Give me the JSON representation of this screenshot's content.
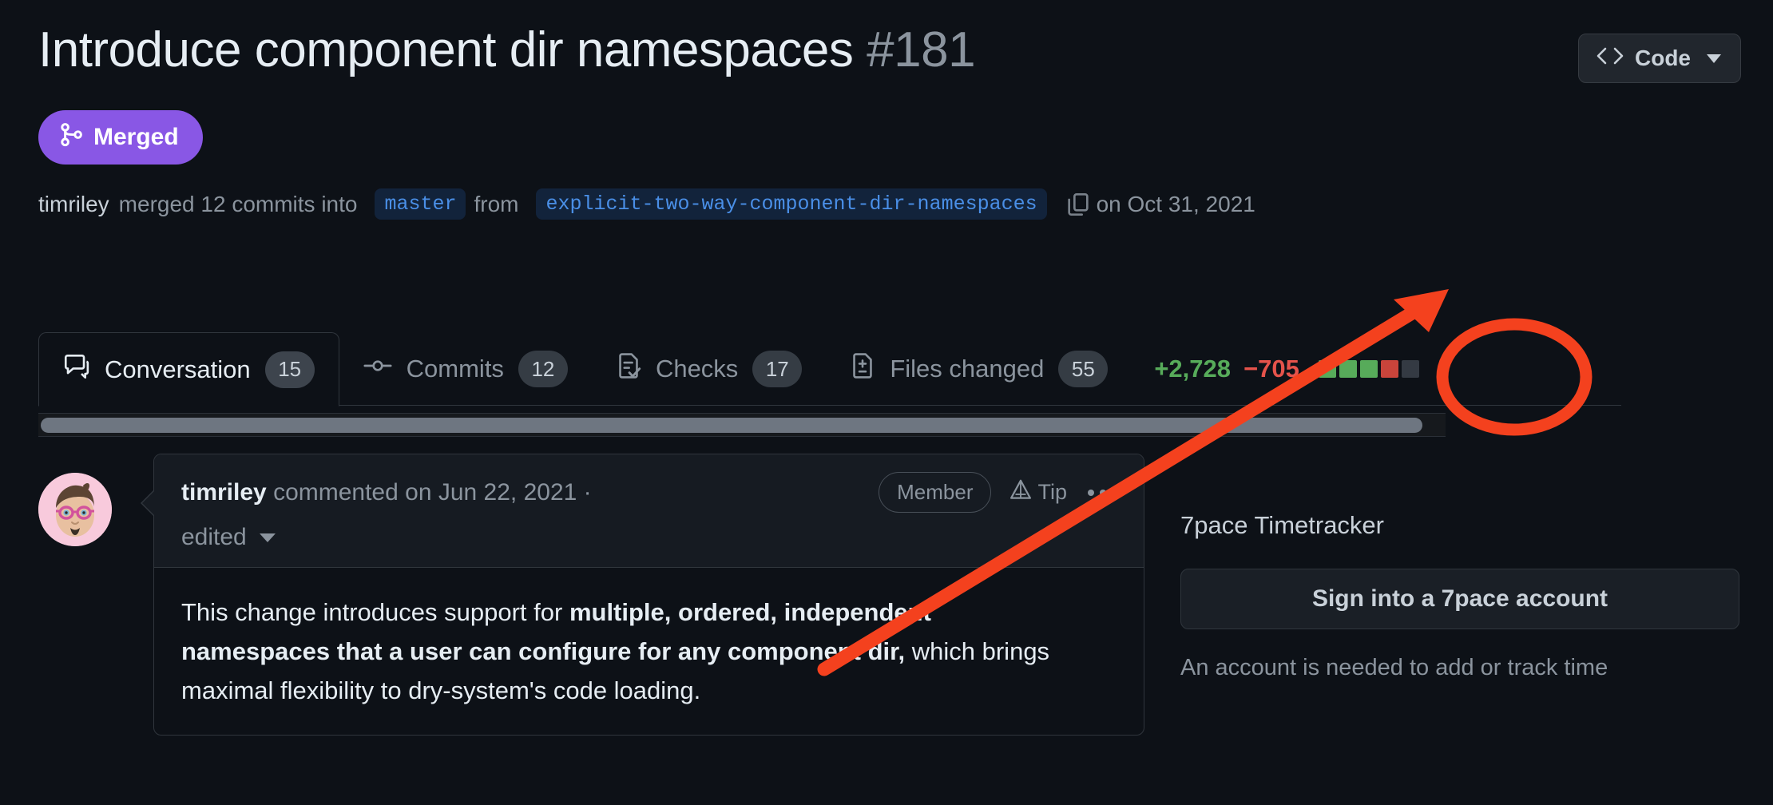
{
  "header": {
    "title": "Introduce component dir namespaces",
    "number": "#181",
    "code_button_label": "Code"
  },
  "state": {
    "badge_label": "Merged",
    "badge_color": "#8957e5"
  },
  "meta": {
    "author": "timriley",
    "action_text": "merged 12 commits into",
    "base_branch": "master",
    "from_text": "from",
    "head_branch": "explicit-two-way-component-dir-namespaces",
    "date_text": "on Oct 31, 2021"
  },
  "tabs": [
    {
      "label": "Conversation",
      "count": "15",
      "icon": "comment-icon",
      "active": true
    },
    {
      "label": "Commits",
      "count": "12",
      "icon": "commit-icon",
      "active": false
    },
    {
      "label": "Checks",
      "count": "17",
      "icon": "checks-icon",
      "active": false
    },
    {
      "label": "Files changed",
      "count": "55",
      "icon": "file-diff-icon",
      "active": false
    }
  ],
  "diffstat": {
    "additions": "+2,728",
    "deletions": "−705",
    "add_color": "#57ab5a",
    "del_color": "#e5534b",
    "blocks": [
      "add",
      "add",
      "add",
      "del",
      "neutral"
    ]
  },
  "comment": {
    "author": "timriley",
    "action": "commented on Jun 22, 2021 ·",
    "edited_label": "edited",
    "role_badge": "Member",
    "tip_label": "Tip",
    "body_parts": [
      {
        "text": "This change introduces support for ",
        "bold": false
      },
      {
        "text": "multiple, ordered, independent namespaces that a user can configure for any component dir,",
        "bold": true
      },
      {
        "text": " which brings maximal flexibility to dry-system's code loading.",
        "bold": false
      }
    ]
  },
  "sidebar": {
    "title": "7pace Timetracker",
    "button_label": "Sign into a 7pace account",
    "note": "An account is needed to add or track time"
  },
  "annotation": {
    "color": "#f4411e",
    "shape": "ellipse-and-arrow",
    "target": "+2,728"
  }
}
